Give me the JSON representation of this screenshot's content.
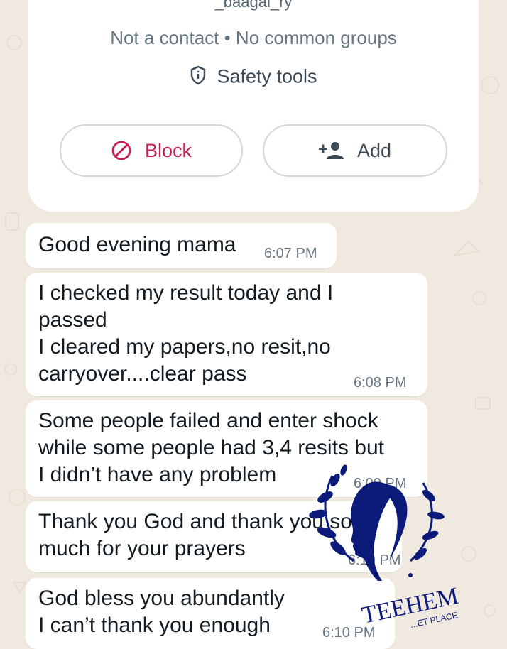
{
  "contact": {
    "name": "_baagal_ry",
    "subtitle": "Not a contact • No common groups",
    "safety_label": "Safety tools",
    "block_label": "Block",
    "add_label": "Add"
  },
  "messages": [
    {
      "text": "Good evening mama",
      "time": "6:07 PM"
    },
    {
      "text": "I checked my result today and I\npassed\nI cleared my papers,no resit,no\ncarryover....clear pass",
      "time": "6:08 PM"
    },
    {
      "text": "Some people failed and enter shock\nwhile some people had 3,4 resits but\nI didn’t have any problem",
      "time": "6:09 PM"
    },
    {
      "text": "Thank you God and thank you so\nmuch for your prayers",
      "time": "6:10 PM"
    },
    {
      "text": "God bless you abundantly\nI can’t thank you enough",
      "time": "6:10 PM"
    }
  ],
  "watermark": {
    "brand": "TEEHEM",
    "tagline": "...ET PLACE"
  },
  "colors": {
    "background": "#efe9df",
    "bubble": "#ffffff",
    "block_red": "#c5204f",
    "watermark_navy": "#0c1a7a"
  }
}
